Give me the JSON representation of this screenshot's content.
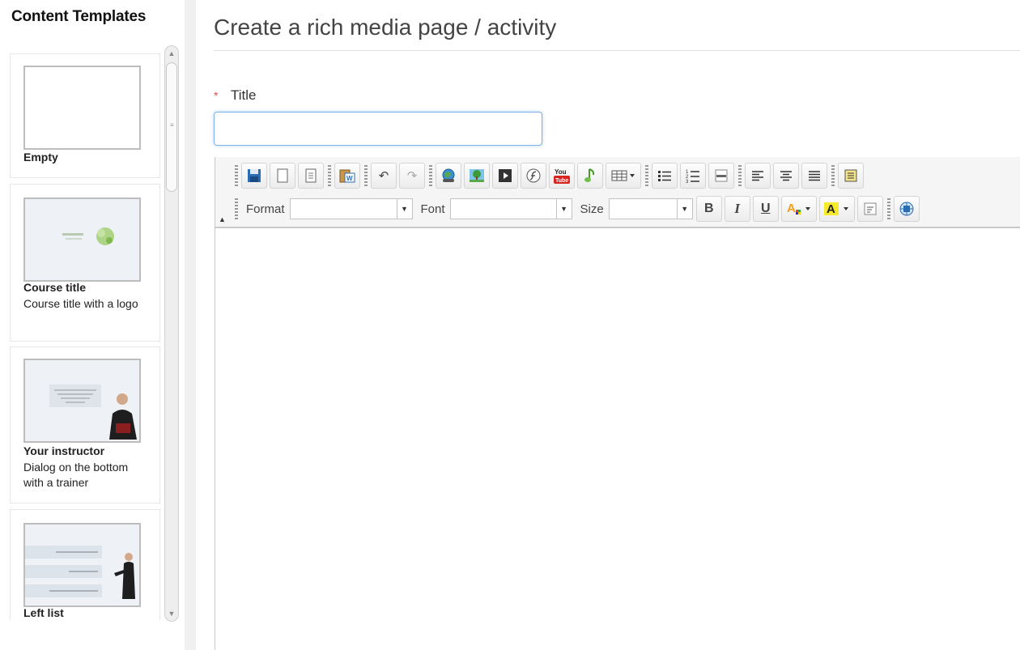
{
  "sidebar": {
    "heading": "Content Templates",
    "templates": [
      {
        "name": "Empty",
        "description": ""
      },
      {
        "name": "Course title",
        "description": "Course title with a logo"
      },
      {
        "name": "Your instructor",
        "description": "Dialog on the bottom with a trainer"
      },
      {
        "name": "Left list",
        "description": ""
      }
    ]
  },
  "main": {
    "page_title": "Create a rich media page / activity",
    "title_field": {
      "required_mark": "*",
      "label": "Title",
      "value": ""
    }
  },
  "toolbar": {
    "row1_icons": [
      "save-icon",
      "new-page-icon",
      "templates-icon",
      "paste-from-word-icon",
      "undo-icon",
      "redo-icon",
      "insert-link-icon",
      "insert-image-icon",
      "insert-video-icon",
      "insert-flash-icon",
      "insert-youtube-icon",
      "insert-audio-icon",
      "insert-table-icon",
      "bulleted-list-icon",
      "numbered-list-icon",
      "horizontal-rule-icon",
      "align-left-icon",
      "align-center-icon",
      "justify-icon",
      "source-icon"
    ],
    "format_label": "Format",
    "font_label": "Font",
    "size_label": "Size",
    "format_value": "",
    "font_value": "",
    "size_value": "",
    "bold": "B",
    "italic": "I",
    "underline": "U",
    "text_color": "A",
    "bg_color": "A",
    "youtube_text": "You Tube"
  },
  "colors": {
    "accent_blue": "#2a6db5",
    "input_focus": "#7fb2e5",
    "required": "#d9534f"
  }
}
